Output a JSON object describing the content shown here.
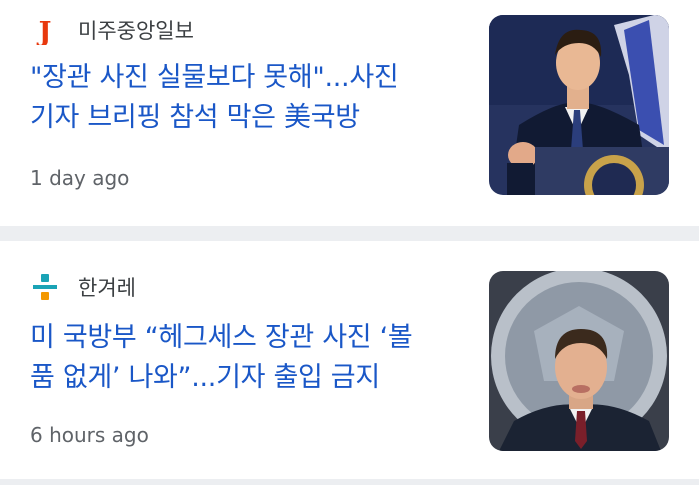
{
  "articles": [
    {
      "source": "미주중앙일보",
      "logo_letter": "J",
      "headline_line1": "\"장관 사진 실물보다 못해\"...사진",
      "headline_line2": "기자 브리핑 참석 막은 美국방",
      "time": "1 day ago",
      "thumbnail_icon": "person-photo-icon"
    },
    {
      "source": "한겨레",
      "headline_line1": "미 국방부 “헤그세스 장관 사진 ‘볼",
      "headline_line2": "품 없게’ 나와”...기자 출입 금지",
      "time": "6 hours ago",
      "thumbnail_icon": "person-photo-icon"
    }
  ],
  "colors": {
    "headline": "#1a57c7",
    "source": "#3c4043",
    "time": "#5f6368",
    "separator": "#eceef1",
    "logo_red": "#e8380d",
    "logo_teal": "#1aa3b5",
    "logo_orange": "#f39800"
  }
}
